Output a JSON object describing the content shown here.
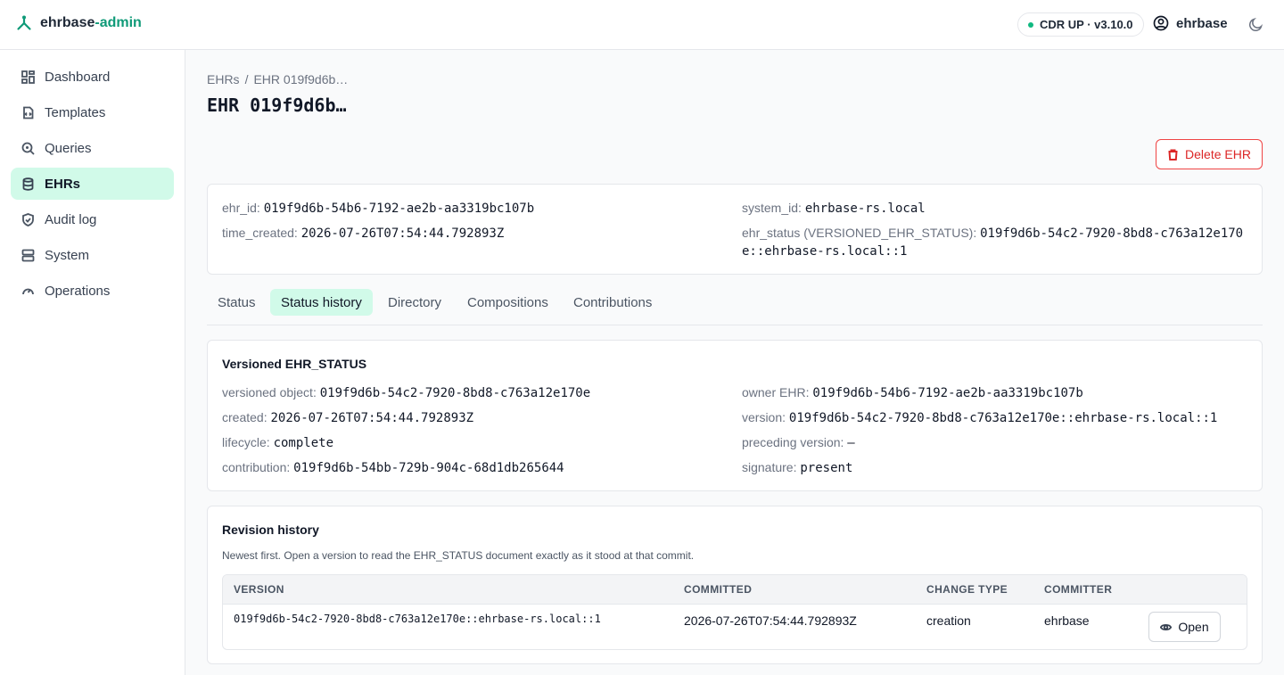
{
  "app": {
    "brand_prefix": "ehrbase",
    "brand_suffix": "-admin"
  },
  "header": {
    "status_badge": "CDR UP · v3.10.0",
    "user": "ehrbase"
  },
  "sidebar": {
    "items": [
      {
        "label": "Dashboard",
        "icon": "dashboard-icon"
      },
      {
        "label": "Templates",
        "icon": "template-icon"
      },
      {
        "label": "Queries",
        "icon": "query-icon"
      },
      {
        "label": "EHRs",
        "icon": "database-icon",
        "active": true
      },
      {
        "label": "Audit log",
        "icon": "shield-icon"
      },
      {
        "label": "System",
        "icon": "server-icon"
      },
      {
        "label": "Operations",
        "icon": "gauge-icon"
      }
    ]
  },
  "breadcrumb": {
    "root": "EHRs",
    "sep": "/",
    "current": "EHR 019f9d6b…"
  },
  "page": {
    "title": "EHR 019f9d6b…",
    "delete_label": "Delete EHR"
  },
  "ehr": {
    "ehr_id_label": "ehr_id:",
    "ehr_id": "019f9d6b-54b6-7192-ae2b-aa3319bc107b",
    "time_created_label": "time_created:",
    "time_created": "2026-07-26T07:54:44.792893Z",
    "system_id_label": "system_id:",
    "system_id": "ehrbase-rs.local",
    "ehr_status_label": "ehr_status (VERSIONED_EHR_STATUS):",
    "ehr_status_line1": "019f9d6b-54c2-7920-8bd8-c763a12e170",
    "ehr_status_line2": "e::ehrbase-rs.local::1"
  },
  "tabs": [
    "Status",
    "Status history",
    "Directory",
    "Compositions",
    "Contributions"
  ],
  "versioned": {
    "title": "Versioned EHR_STATUS",
    "versioned_object_label": "versioned object:",
    "versioned_object": "019f9d6b-54c2-7920-8bd8-c763a12e170e",
    "created_label": "created:",
    "created": "2026-07-26T07:54:44.792893Z",
    "lifecycle_label": "lifecycle:",
    "lifecycle": "complete",
    "contribution_label": "contribution:",
    "contribution": "019f9d6b-54bb-729b-904c-68d1db265644",
    "owner_label": "owner EHR:",
    "owner": "019f9d6b-54b6-7192-ae2b-aa3319bc107b",
    "version_label": "version:",
    "version": "019f9d6b-54c2-7920-8bd8-c763a12e170e::ehrbase-rs.local::1",
    "preceding_label": "preceding version:",
    "preceding": "—",
    "signature_label": "signature:",
    "signature": "present"
  },
  "revision": {
    "title": "Revision history",
    "subtitle": "Newest first. Open a version to read the EHR_STATUS document exactly as it stood at that commit.",
    "columns": [
      "VERSION",
      "COMMITTED",
      "CHANGE TYPE",
      "COMMITTER"
    ],
    "rows": [
      {
        "version": "019f9d6b-54c2-7920-8bd8-c763a12e170e::ehrbase-rs.local::1",
        "committed": "2026-07-26T07:54:44.792893Z",
        "change_type": "creation",
        "committer": "ehrbase",
        "action": "Open"
      }
    ]
  },
  "colors": {
    "accent": "#0f9a78",
    "active_bg": "#d1fae9",
    "danger": "#dc2626"
  }
}
